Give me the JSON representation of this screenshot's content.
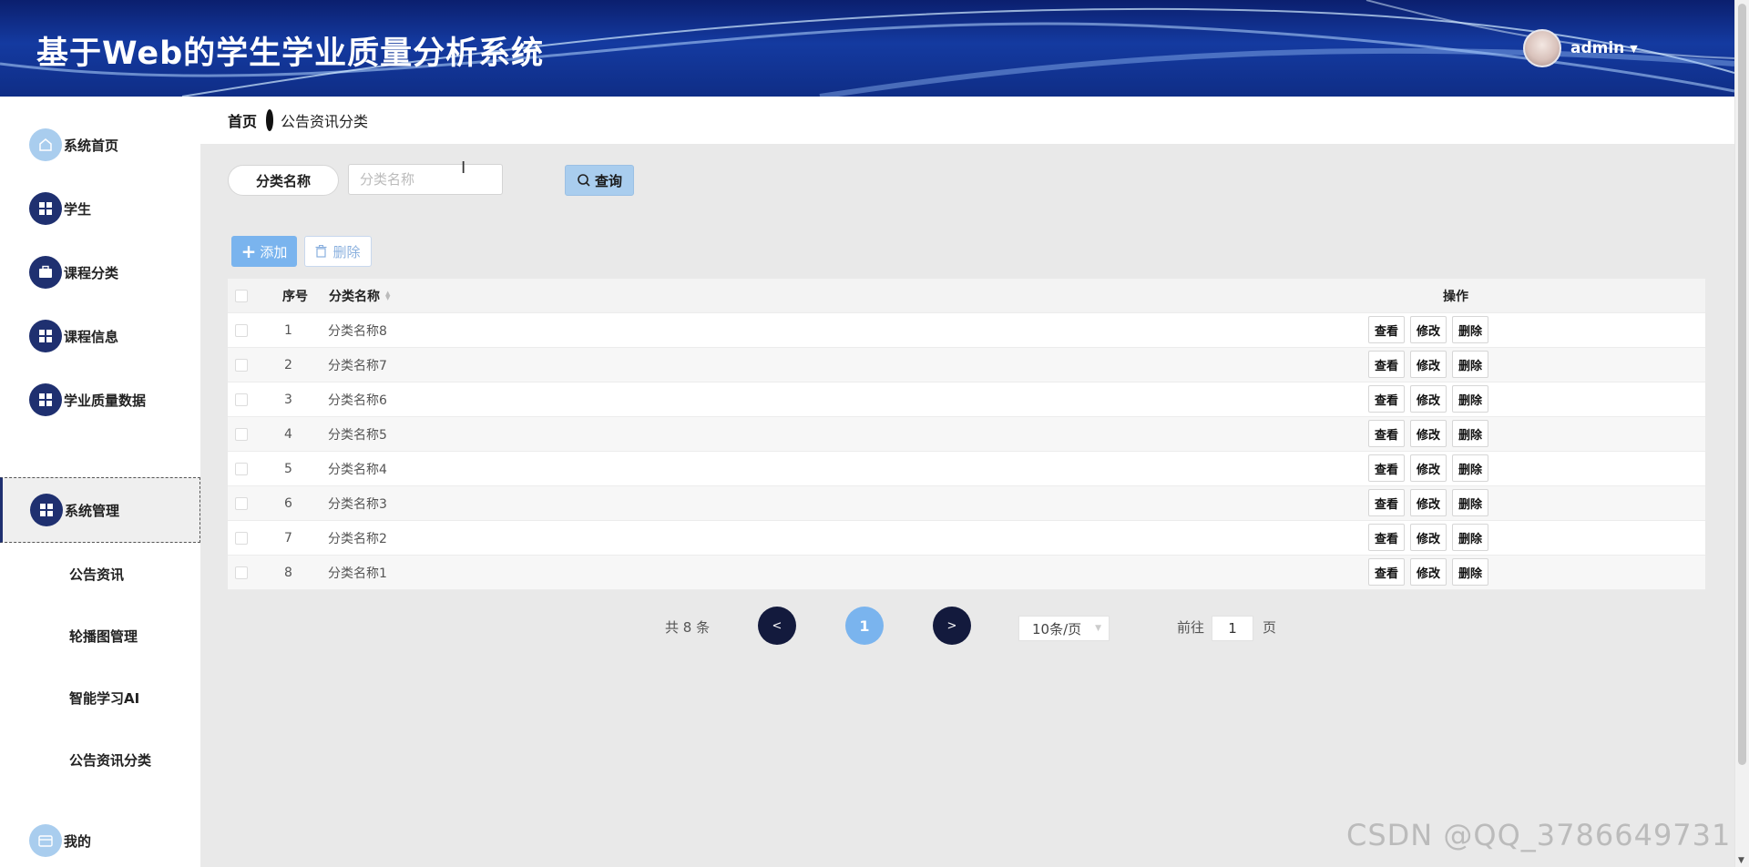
{
  "header": {
    "title": "基于Web的学生学业质量分析系统",
    "user": {
      "name": "admin"
    }
  },
  "sidebar": {
    "items": [
      {
        "label": "系统首页",
        "icon": "home-icon"
      },
      {
        "label": "学生",
        "icon": "grid-icon"
      },
      {
        "label": "课程分类",
        "icon": "briefcase-icon"
      },
      {
        "label": "课程信息",
        "icon": "grid-icon"
      },
      {
        "label": "学业质量数据",
        "icon": "grid-icon"
      },
      {
        "label": "系统管理",
        "icon": "grid-icon",
        "active": true
      },
      {
        "label": "我的",
        "icon": "card-icon"
      }
    ],
    "sub_items": [
      "公告资讯",
      "轮播图管理",
      "智能学习AI",
      "公告资讯分类"
    ]
  },
  "breadcrumb": {
    "home": "首页",
    "current": "公告资讯分类"
  },
  "search": {
    "label": "分类名称",
    "placeholder": "分类名称",
    "value": "",
    "button": "查询"
  },
  "actions": {
    "add": "添加",
    "delete": "删除"
  },
  "table": {
    "columns": {
      "index": "序号",
      "name": "分类名称",
      "ops": "操作"
    },
    "rows": [
      {
        "index": "1",
        "name": "分类名称8"
      },
      {
        "index": "2",
        "name": "分类名称7"
      },
      {
        "index": "3",
        "name": "分类名称6"
      },
      {
        "index": "4",
        "name": "分类名称5"
      },
      {
        "index": "5",
        "name": "分类名称4"
      },
      {
        "index": "6",
        "name": "分类名称3"
      },
      {
        "index": "7",
        "name": "分类名称2"
      },
      {
        "index": "8",
        "name": "分类名称1"
      }
    ],
    "row_actions": {
      "view": "查看",
      "edit": "修改",
      "delete": "删除"
    }
  },
  "pagination": {
    "total": "共 8 条",
    "prev": "<",
    "next": ">",
    "current": "1",
    "page_size": "10条/页",
    "goto_label": "前往",
    "goto_value": "1",
    "goto_unit": "页"
  },
  "watermark": "CSDN @QQ_3786649731",
  "colors": {
    "header_blue": "#143aa0",
    "sidebar_icon": "#1f3070",
    "accent_light": "#a9cdee",
    "primary": "#7ab4ee",
    "pager_dark": "#131a3d"
  }
}
